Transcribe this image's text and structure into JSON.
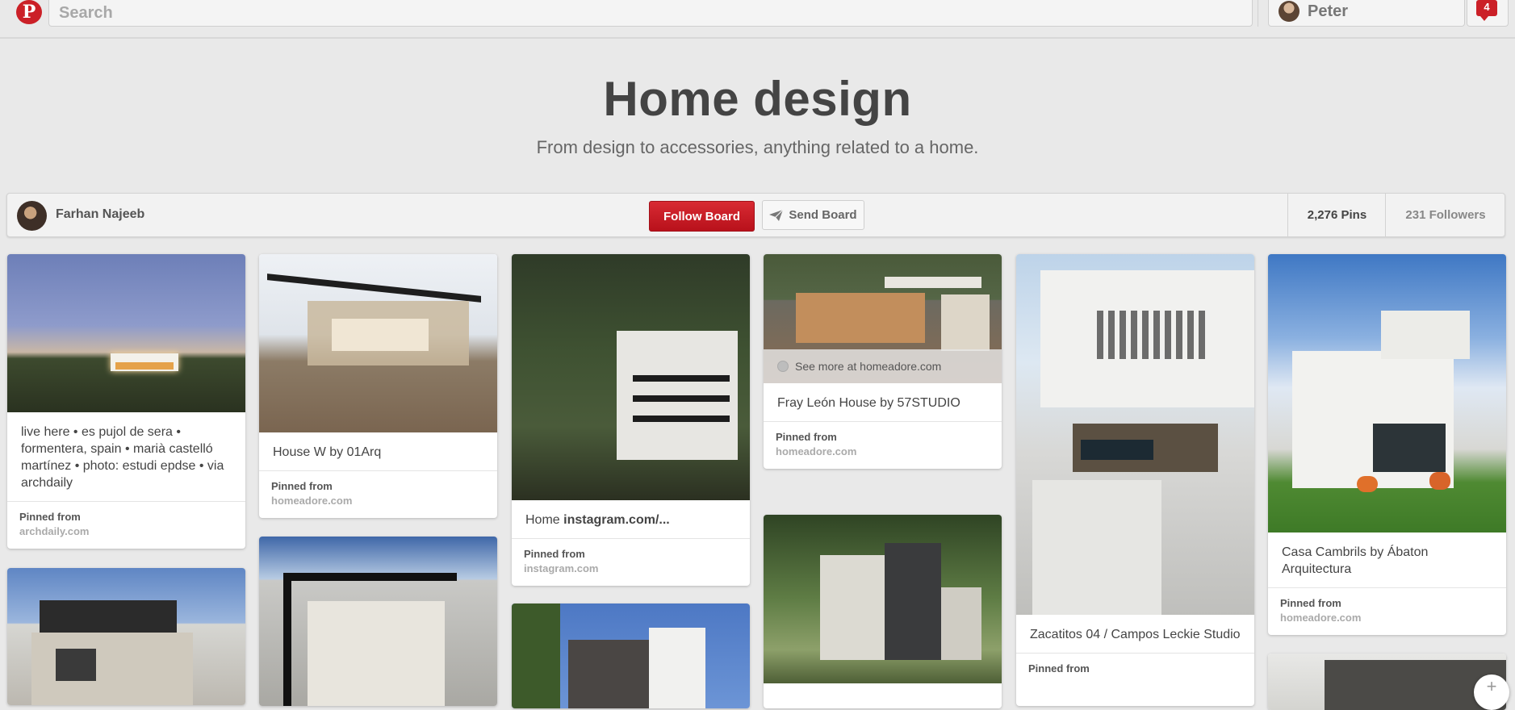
{
  "header": {
    "logo": "P",
    "search_placeholder": "Search",
    "user_name": "Peter",
    "notification_count": "4"
  },
  "board": {
    "title": "Home design",
    "description": "From design to accessories, anything related to a home.",
    "owner": "Farhan Najeeb",
    "follow_label": "Follow Board",
    "send_label": "Send Board",
    "pins_count": "2,276 Pins",
    "followers_count": "231 Followers"
  },
  "pins": [
    {
      "desc": "live here • es pujol de sera • formentera, spain • marià castelló martínez • photo: estudi epdse • via archdaily",
      "pinned_label": "Pinned from",
      "domain": "archdaily.com"
    },
    {
      "desc": "House W by 01Arq",
      "pinned_label": "Pinned from",
      "domain": "homeadore.com"
    },
    {
      "desc_prefix": "Home ",
      "desc_bold": "instagram.com/...",
      "pinned_label": "Pinned from",
      "domain": "instagram.com"
    },
    {
      "see_more": "See more at homeadore.com",
      "desc": "Fray León House by 57STUDIO",
      "pinned_label": "Pinned from",
      "domain": "homeadore.com"
    },
    {
      "desc": "Zacatitos 04 / Campos Leckie Studio",
      "pinned_label": "Pinned from"
    },
    {
      "desc": "Casa Cambrils by Ábaton Arquitectura",
      "pinned_label": "Pinned from",
      "domain": "homeadore.com"
    }
  ],
  "colors": {
    "brand_red": "#cb2027",
    "background": "#e9e9e9"
  }
}
